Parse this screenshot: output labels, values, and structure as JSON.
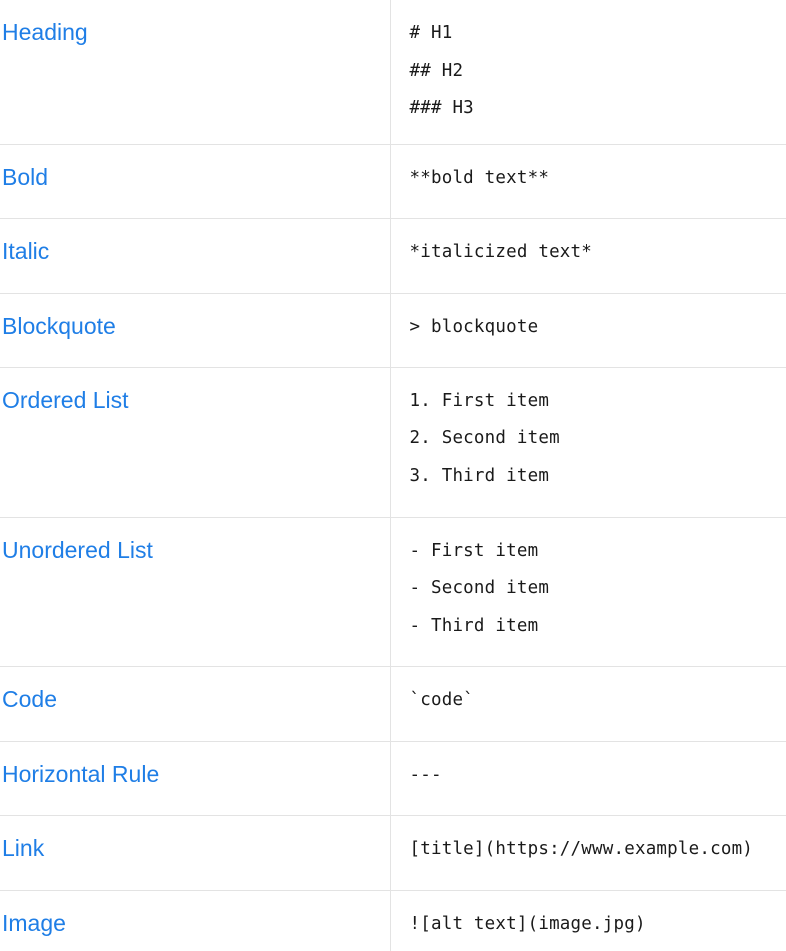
{
  "rows": [
    {
      "element": "Heading",
      "syntax": [
        "# H1",
        "## H2",
        "### H3"
      ]
    },
    {
      "element": "Bold",
      "syntax": [
        "**bold text**"
      ]
    },
    {
      "element": "Italic",
      "syntax": [
        "*italicized text*"
      ]
    },
    {
      "element": "Blockquote",
      "syntax": [
        "> blockquote"
      ]
    },
    {
      "element": "Ordered List",
      "syntax": [
        "1. First item",
        "2. Second item",
        "3. Third item"
      ]
    },
    {
      "element": "Unordered List",
      "syntax": [
        "- First item",
        "- Second item",
        "- Third item"
      ]
    },
    {
      "element": "Code",
      "syntax": [
        "`code`"
      ]
    },
    {
      "element": "Horizontal Rule",
      "syntax": [
        "---"
      ]
    },
    {
      "element": "Link",
      "syntax": [
        "[title](https://www.example.com)"
      ]
    },
    {
      "element": "Image",
      "syntax": [
        "![alt text](image.jpg)"
      ]
    }
  ],
  "colors": {
    "link": "#1f7ee6",
    "text": "#1a1a1a",
    "border": "#e3e3e3"
  }
}
